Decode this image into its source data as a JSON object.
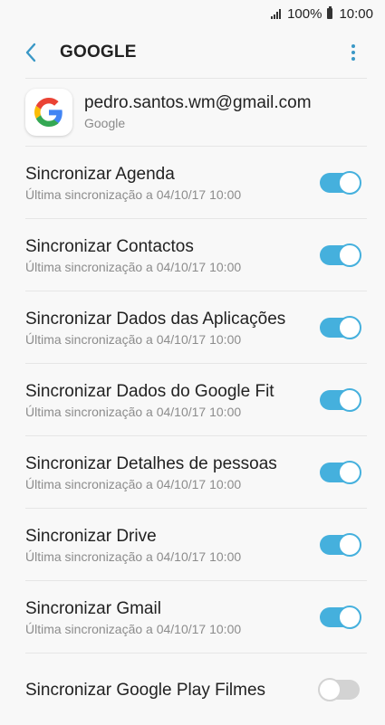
{
  "status_bar": {
    "battery": "100%",
    "time": "10:00"
  },
  "header": {
    "title": "GOOGLE"
  },
  "account": {
    "email": "pedro.santos.wm@gmail.com",
    "type": "Google"
  },
  "sync_items": [
    {
      "title": "Sincronizar Agenda",
      "subtitle": "Última sincronização a 04/10/17  10:00",
      "enabled": true
    },
    {
      "title": "Sincronizar Contactos",
      "subtitle": "Última sincronização a 04/10/17  10:00",
      "enabled": true
    },
    {
      "title": "Sincronizar Dados das Aplicações",
      "subtitle": "Última sincronização a 04/10/17  10:00",
      "enabled": true
    },
    {
      "title": "Sincronizar Dados do Google Fit",
      "subtitle": "Última sincronização a 04/10/17  10:00",
      "enabled": true
    },
    {
      "title": "Sincronizar Detalhes de pessoas",
      "subtitle": "Última sincronização a 04/10/17  10:00",
      "enabled": true
    },
    {
      "title": "Sincronizar Drive",
      "subtitle": "Última sincronização a 04/10/17  10:00",
      "enabled": true
    },
    {
      "title": "Sincronizar Gmail",
      "subtitle": "Última sincronização a 04/10/17  10:00",
      "enabled": true
    },
    {
      "title": "Sincronizar Google Play Filmes",
      "subtitle": "",
      "enabled": false
    }
  ],
  "colors": {
    "accent": "#45b0dd",
    "icon_blue": "#3a98c6",
    "toggle_off": "#d3d3d3"
  }
}
